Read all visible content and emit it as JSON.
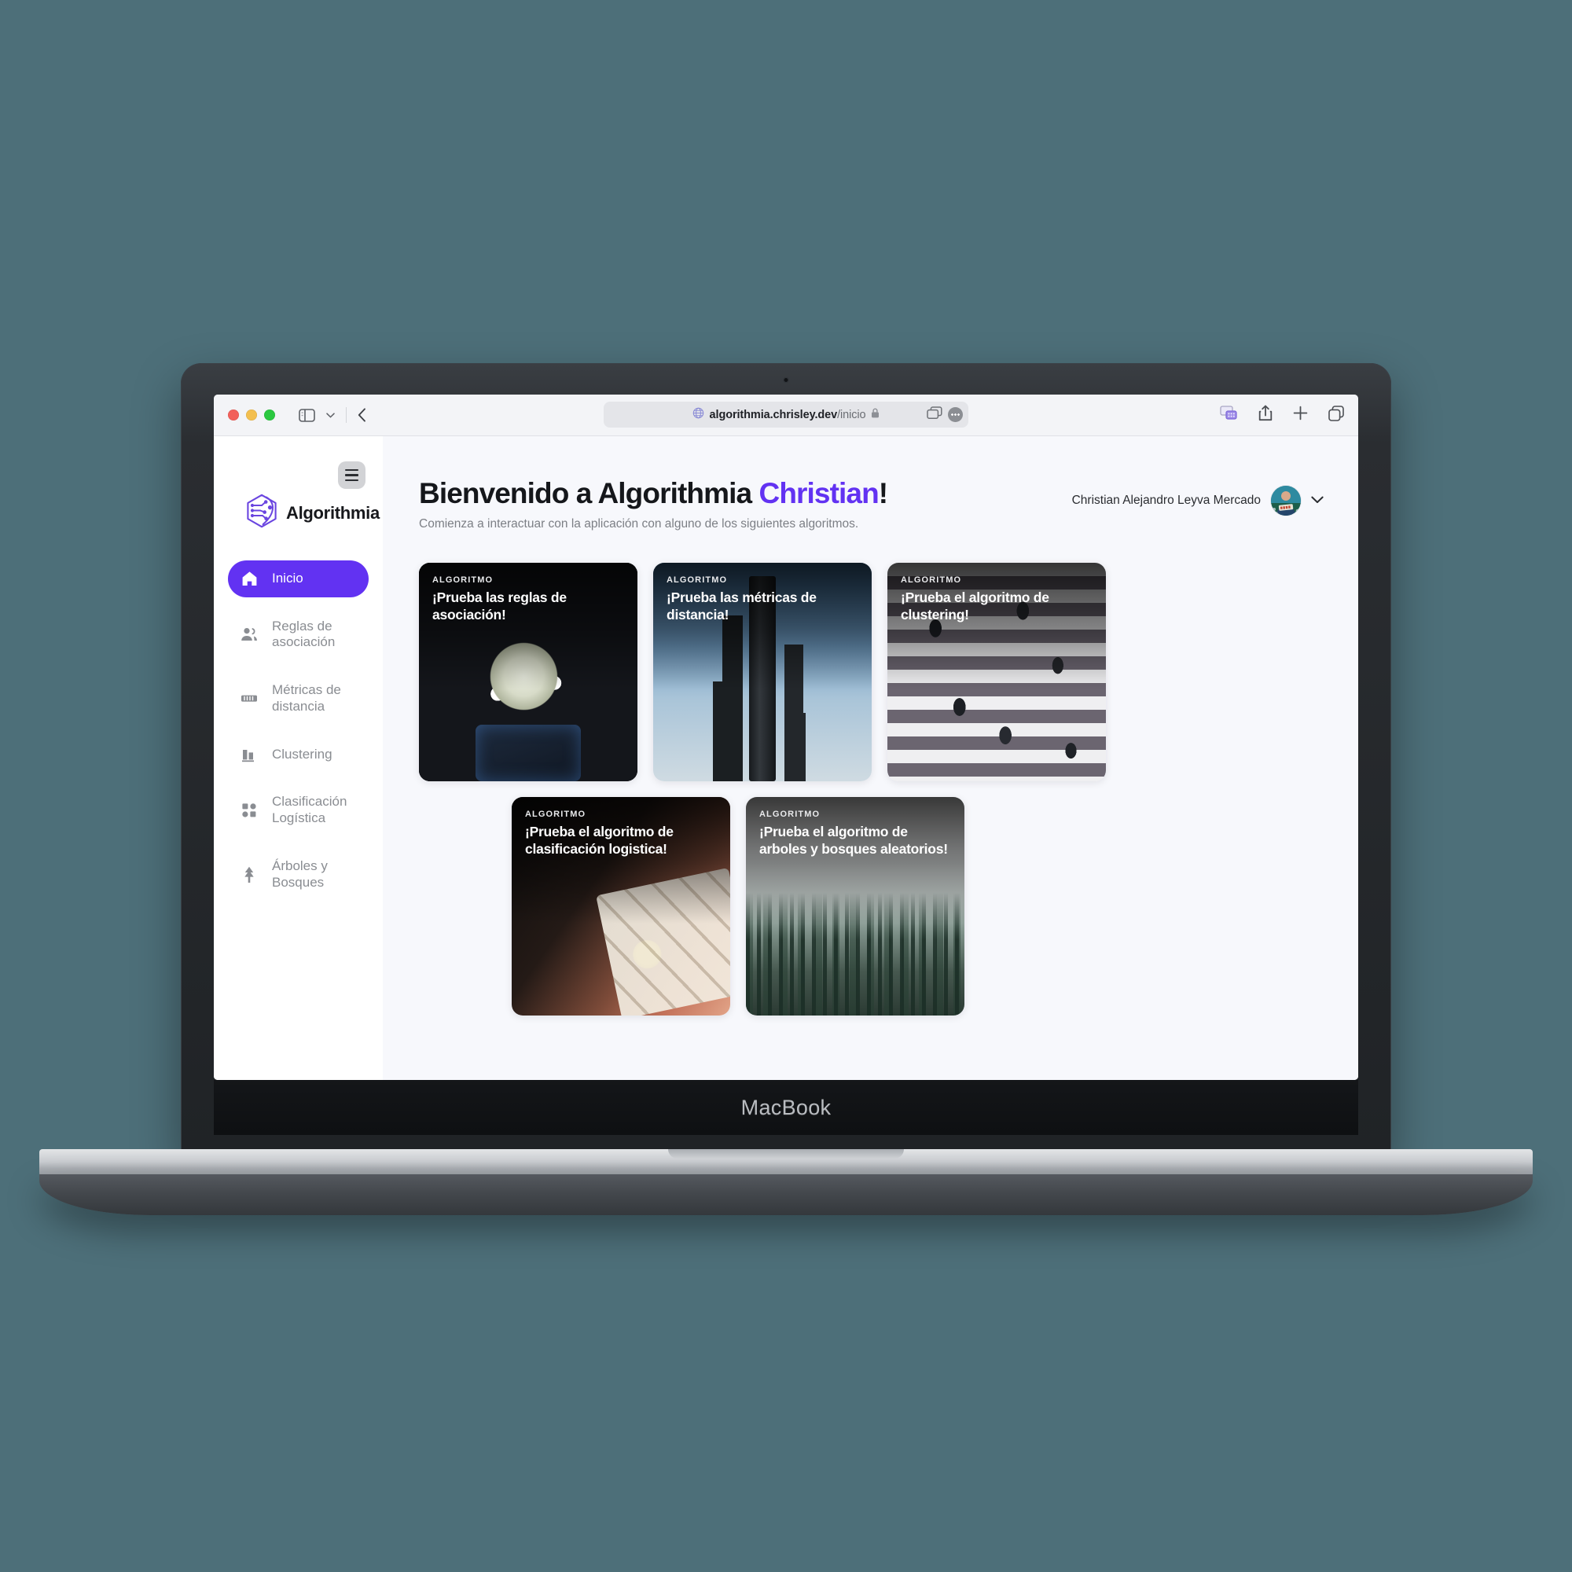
{
  "device": {
    "label": "MacBook"
  },
  "browser": {
    "url_host": "algorithmia.chrisley.dev",
    "url_path": "/inicio",
    "icons": {
      "sidebar_toggle": "sidebar-toggle-icon",
      "tab_group_chevron": "chevron-down-icon",
      "back": "back-arrow-icon",
      "globe": "globe-icon",
      "lock": "lock-icon",
      "tab_overview": "tab-overview-icon",
      "page_menu": "ellipsis-icon",
      "extension": "extension-icon",
      "share": "share-icon",
      "new_tab": "plus-icon",
      "tabs": "copy-tabs-icon"
    }
  },
  "sidebar": {
    "menu_button": "hamburger-icon",
    "brand": "Algorithmia",
    "items": [
      {
        "label": "Inicio",
        "icon": "home-icon",
        "active": true
      },
      {
        "label": "Reglas de\nasociación",
        "icon": "people-icon",
        "active": false
      },
      {
        "label": "Métricas de\ndistancia",
        "icon": "ruler-icon",
        "active": false
      },
      {
        "label": "Clustering",
        "icon": "bar-chart-icon",
        "active": false
      },
      {
        "label": "Clasificación\nLogística",
        "icon": "grid-dots-icon",
        "active": false
      },
      {
        "label": "Árboles y\nBosques",
        "icon": "tree-icon",
        "active": false
      }
    ]
  },
  "header": {
    "title_prefix": "Bienvenido a Algorithmia ",
    "title_name": "Christian",
    "title_suffix": "!",
    "subtitle": "Comienza a interactuar con la aplicación con alguno de los siguientes algoritmos.",
    "user_name": "Christian Alejandro Leyva Mercado",
    "avatar": "user-avatar",
    "chevron": "chevron-down-icon"
  },
  "cards": [
    {
      "kicker": "ALGORITMO",
      "title": "¡Prueba las reglas de asociación!",
      "art": "art-robot"
    },
    {
      "kicker": "ALGORITMO",
      "title": "¡Prueba las métricas de distancia!",
      "art": "art-signs"
    },
    {
      "kicker": "ALGORITMO",
      "title": "¡Prueba el algoritmo de clustering!",
      "art": "art-cross"
    },
    {
      "kicker": "ALGORITMO",
      "title": "¡Prueba el algoritmo de clasificación logistica!",
      "art": "art-tarot"
    },
    {
      "kicker": "ALGORITMO",
      "title": "¡Prueba el algoritmo de arboles y bosques aleatorios!",
      "art": "art-forest"
    }
  ],
  "colors": {
    "accent": "#6232f2",
    "page_bg": "#f7f8fc",
    "sidebar_bg": "#ffffff",
    "backdrop": "#4d6f79",
    "muted_text": "#8a8d92"
  }
}
